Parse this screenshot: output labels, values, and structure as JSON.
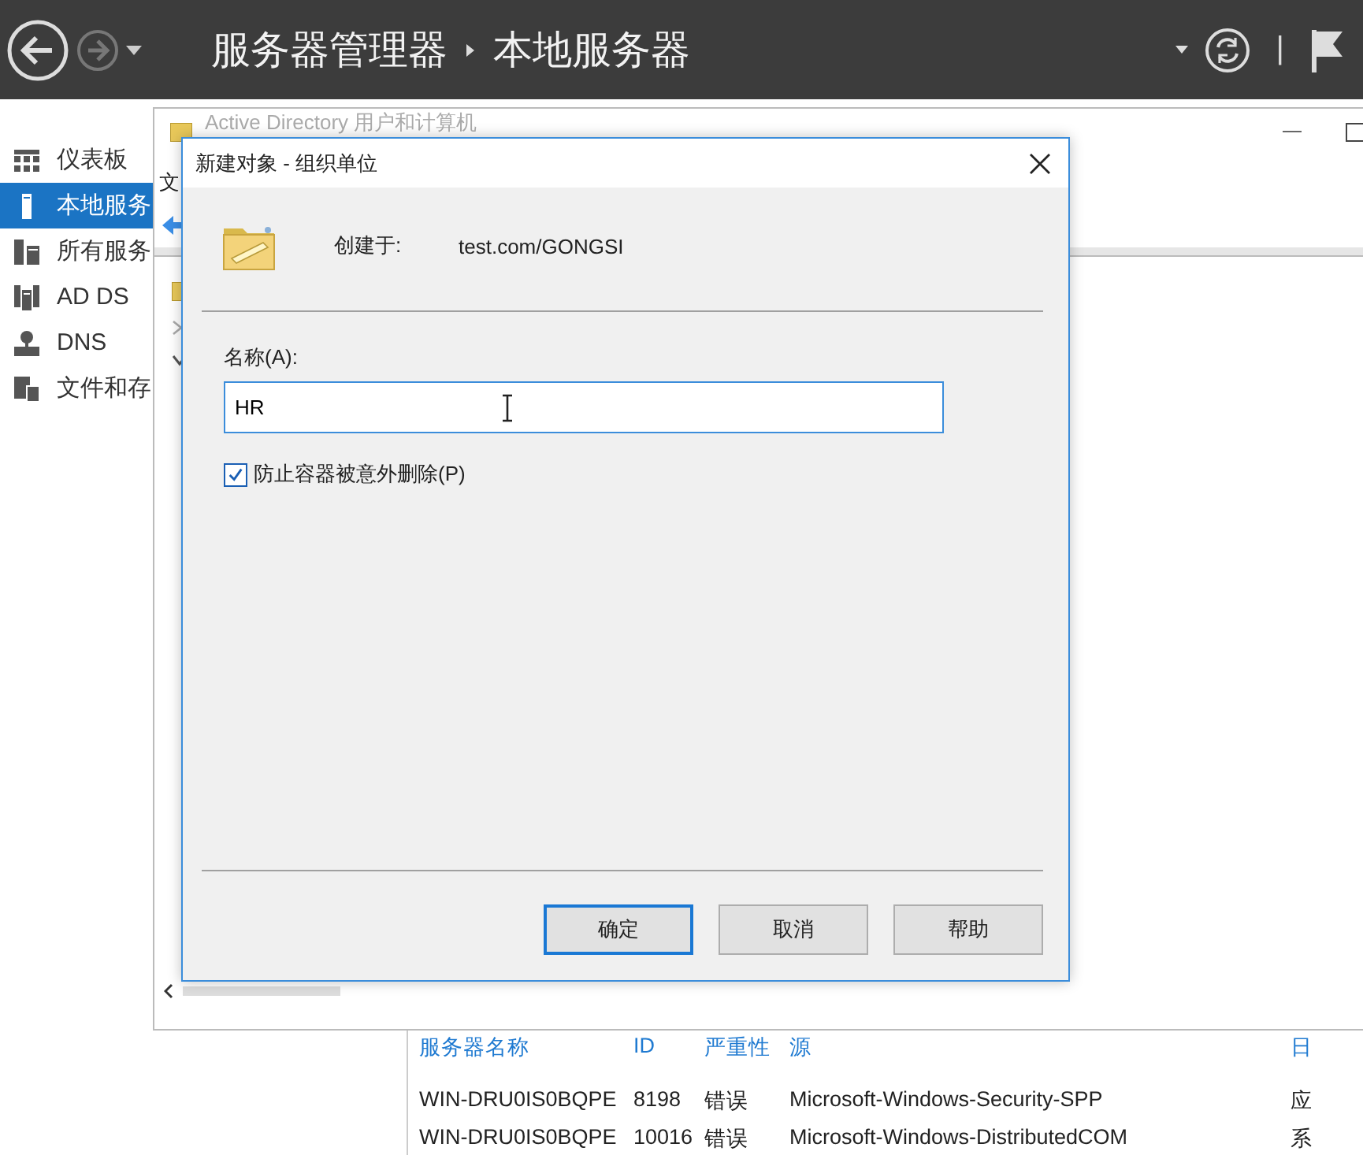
{
  "header": {
    "breadcrumb": [
      "服务器管理器",
      "本地服务器"
    ],
    "separator": "|"
  },
  "sidebar": {
    "items": [
      {
        "label": "仪表板",
        "selected": false
      },
      {
        "label": "本地服务",
        "selected": true
      },
      {
        "label": "所有服务",
        "selected": false
      },
      {
        "label": "AD DS",
        "selected": false
      },
      {
        "label": "DNS",
        "selected": false
      },
      {
        "label": "文件和存",
        "selected": false
      }
    ]
  },
  "background_window": {
    "title": "Active Directory 用户和计算机",
    "menu_fragment": "文"
  },
  "events_table": {
    "columns": [
      "服务器名称",
      "ID",
      "严重性",
      "源",
      "日"
    ],
    "rows": [
      [
        "WIN-DRU0IS0BQPE",
        "8198",
        "错误",
        "Microsoft-Windows-Security-SPP",
        "应"
      ],
      [
        "WIN-DRU0IS0BQPE",
        "10016",
        "错误",
        "Microsoft-Windows-DistributedCOM",
        "系"
      ]
    ]
  },
  "dialog": {
    "title": "新建对象 - 组织单位",
    "created_in_label": "创建于:",
    "created_in_value": "test.com/GONGSI",
    "name_label": "名称(A):",
    "name_value": "HR",
    "protect": {
      "label": "防止容器被意外删除(P)",
      "checked": true
    },
    "buttons": [
      {
        "label": "确定",
        "default": true
      },
      {
        "label": "取消",
        "default": false
      },
      {
        "label": "帮助",
        "default": false
      }
    ]
  }
}
